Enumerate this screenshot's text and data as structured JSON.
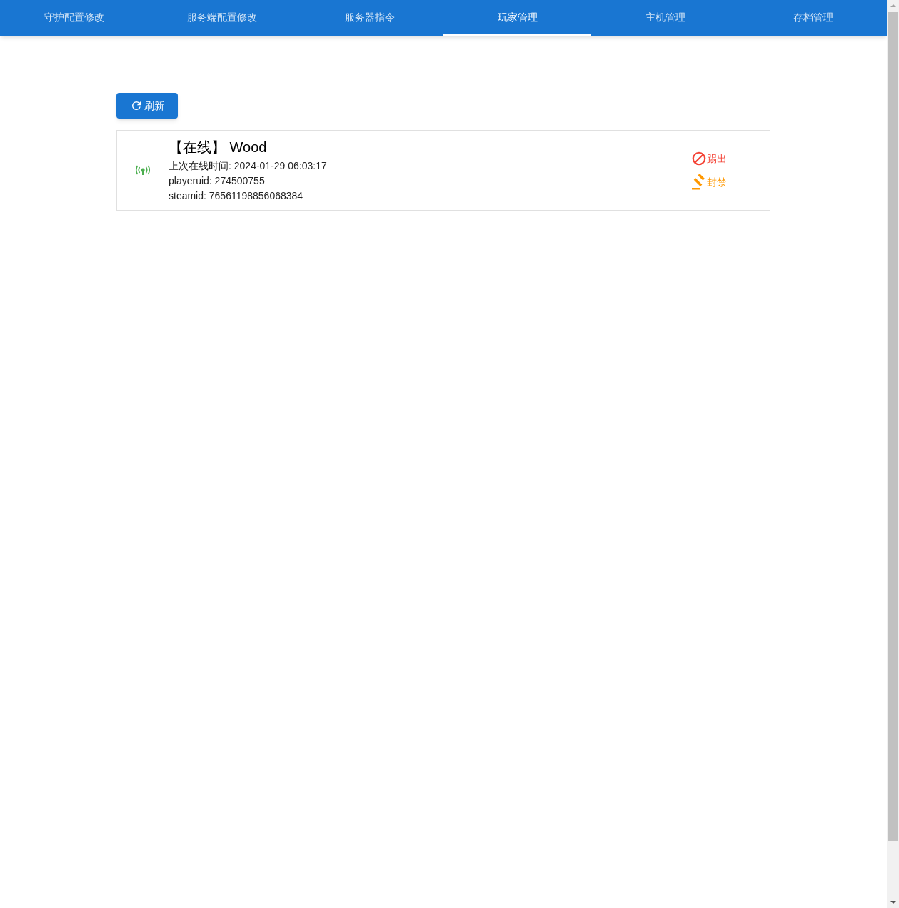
{
  "tabs": [
    {
      "label": "守护配置修改",
      "selected": false
    },
    {
      "label": "服务端配置修改",
      "selected": false
    },
    {
      "label": "服务器指令",
      "selected": false
    },
    {
      "label": "玩家管理",
      "selected": true
    },
    {
      "label": "主机管理",
      "selected": false
    },
    {
      "label": "存档管理",
      "selected": false
    }
  ],
  "refresh_button": "刷新",
  "players": [
    {
      "online": true,
      "title": "【在线】 Wood",
      "last_online": "上次在线时间: 2024-01-29 06:03:17",
      "playeruid": "playeruid: 274500755",
      "steamid": "steamid: 76561198856068384",
      "actions": [
        {
          "kind": "kick",
          "label": "踢出"
        },
        {
          "kind": "ban",
          "label": "封禁"
        }
      ]
    }
  ]
}
